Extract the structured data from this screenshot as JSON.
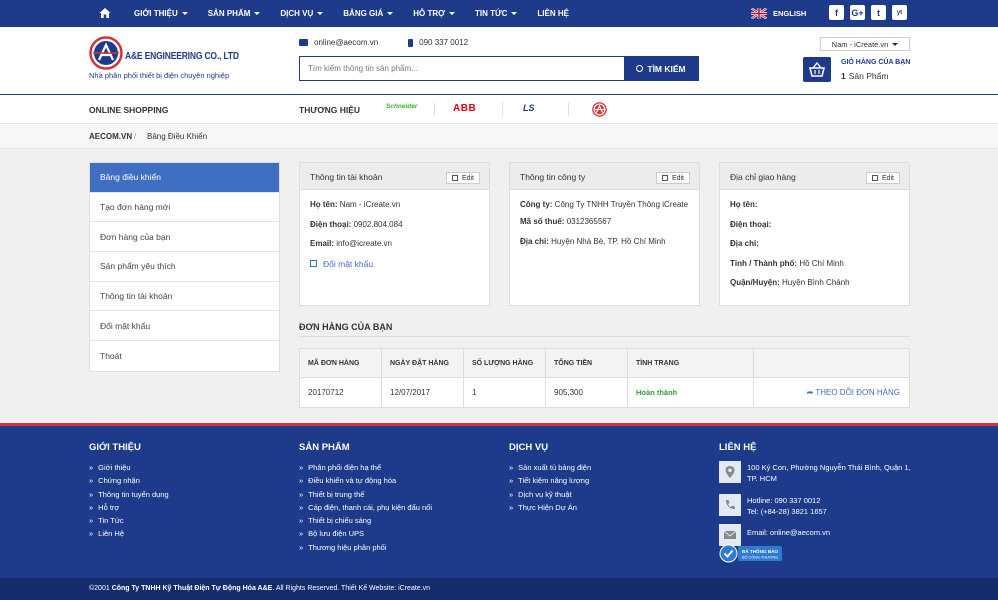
{
  "topnav": {
    "menu": [
      "GIỚI THIỆU",
      "SẢN PHẨM",
      "DỊCH VỤ",
      "BẢNG GIÁ",
      "HỖ TRỢ",
      "TIN TỨC",
      "LIÊN HỆ"
    ],
    "language": "ENGLISH",
    "social": [
      "f",
      "G+",
      "t",
      "yt"
    ]
  },
  "header": {
    "logo_name": "A&E ENGINEERING CO., LTD",
    "tagline": "Nhà phân phối thiết bị điện chuyên nghiệp",
    "email": "online@aecom.vn",
    "phone": "090 337 0012",
    "search_placeholder": "Tìm kiếm thông tin sản phẩm...",
    "search_button": "TÌM KIẾM",
    "user": "Nam - iCreate.vn",
    "cart_title": "GIỎ HÀNG CỦA BẠN",
    "cart_count": "1",
    "cart_unit": "Sản Phẩm"
  },
  "brandbar": {
    "online_shopping": "ONLINE SHOPPING",
    "brands_label": "THƯƠNG HIỆU",
    "brands": [
      "Schneider",
      "ABB",
      "LS"
    ]
  },
  "breadcrumb": {
    "home": "AECOM.VN",
    "separator": "/",
    "current": "Bảng Điều Khiển"
  },
  "sidebar": {
    "items": [
      "Bảng điều khiển",
      "Tạo đơn hàng mới",
      "Đơn hàng của bạn",
      "Sản phẩm yêu thích",
      "Thông tin tài khoản",
      "Đổi mật khẩu",
      "Thoát"
    ]
  },
  "account": {
    "title": "Thông tin tài khoản",
    "edit": "Edit",
    "name_label": "Họ tên:",
    "name": "Nam - iCreate.vn",
    "phone_label": "Điện thoại:",
    "phone": "0902.804.084",
    "email_label": "Email:",
    "email": "info@icreate.vn",
    "change_password": "Đổi mật khẩu"
  },
  "company": {
    "title": "Thông tin công ty",
    "edit": "Edit",
    "company_label": "Công ty:",
    "company": "Công Ty TNHH Truyền Thông iCreate",
    "tax_label": "Mã số thuế:",
    "tax": "0312365567",
    "address_label": "Địa chỉ:",
    "address": "Huyện Nhà Bè, TP. Hồ Chí Minh"
  },
  "shipping": {
    "title": "Địa chỉ giao hàng",
    "edit": "Edit",
    "name_label": "Họ tên:",
    "phone_label": "Điện thoại:",
    "address_label": "Địa chỉ:",
    "city_label": "Tỉnh / Thành phố:",
    "city": "Hồ Chí Minh",
    "district_label": "Quận/Huyện:",
    "district": "Huyện Bình Chánh"
  },
  "orders": {
    "title": "ĐƠN HÀNG CỦA BẠN",
    "columns": [
      "MÃ ĐƠN HÀNG",
      "NGÀY ĐẶT HÀNG",
      "SỐ LƯỢNG HÀNG",
      "TỔNG TIỀN",
      "TÌNH TRẠNG"
    ],
    "rows": [
      {
        "id": "20170712",
        "date": "12/07/2017",
        "qty": "1",
        "total": "905,300",
        "status": "Hoàn thành",
        "track": "THEO DÕI ĐƠN HÀNG"
      }
    ]
  },
  "footer": {
    "col1": {
      "title": "GIỚI THIỆU",
      "links": [
        "Giới thiệu",
        "Chứng nhận",
        "Thông tin tuyển dụng",
        "Hỗ trợ",
        "Tin Tức",
        "Liên Hệ"
      ]
    },
    "col2": {
      "title": "SẢN PHẨM",
      "links": [
        "Phân phối điện hạ thế",
        "Điều khiển và tự động hóa",
        "Thiết bị trung thế",
        "Cáp điện, thanh cái, phụ kiện đấu nối",
        "Thiết bị chiếu sáng",
        "Bộ lưu điện UPS",
        "Thương hiệu phân phối"
      ]
    },
    "col3": {
      "title": "DỊCH VỤ",
      "links": [
        "Sản xuất tủ bảng điện",
        "Tiết kiệm năng lượng",
        "Dịch vụ kỹ thuật",
        "Thực Hiện Dự Án"
      ]
    },
    "contact": {
      "title": "LIÊN HỆ",
      "address": "100 Ký Con, Phường Nguyễn Thái Bình, Quận 1, TP. HCM",
      "hotline": "Hotline: 090 337 0012",
      "tel": "Tel: (+84-28) 3821 1657",
      "email": "Email: online@aecom.vn",
      "badge_line1": "ĐÃ THÔNG BÁO",
      "badge_line2": "BỘ CÔNG THƯƠNG"
    },
    "copyright_prefix": "©2001 ",
    "company": "Công Ty TNHH Kỹ Thuật Điện Tự Động Hóa A&E",
    "copyright_suffix": ". All Rights Reserved. Thiết Kế Website: iCreate.vn"
  },
  "colors": {
    "primary": "#1e3a8a",
    "accent": "#3f6fc2",
    "red": "#d0343a",
    "success": "#3a9a3a"
  }
}
